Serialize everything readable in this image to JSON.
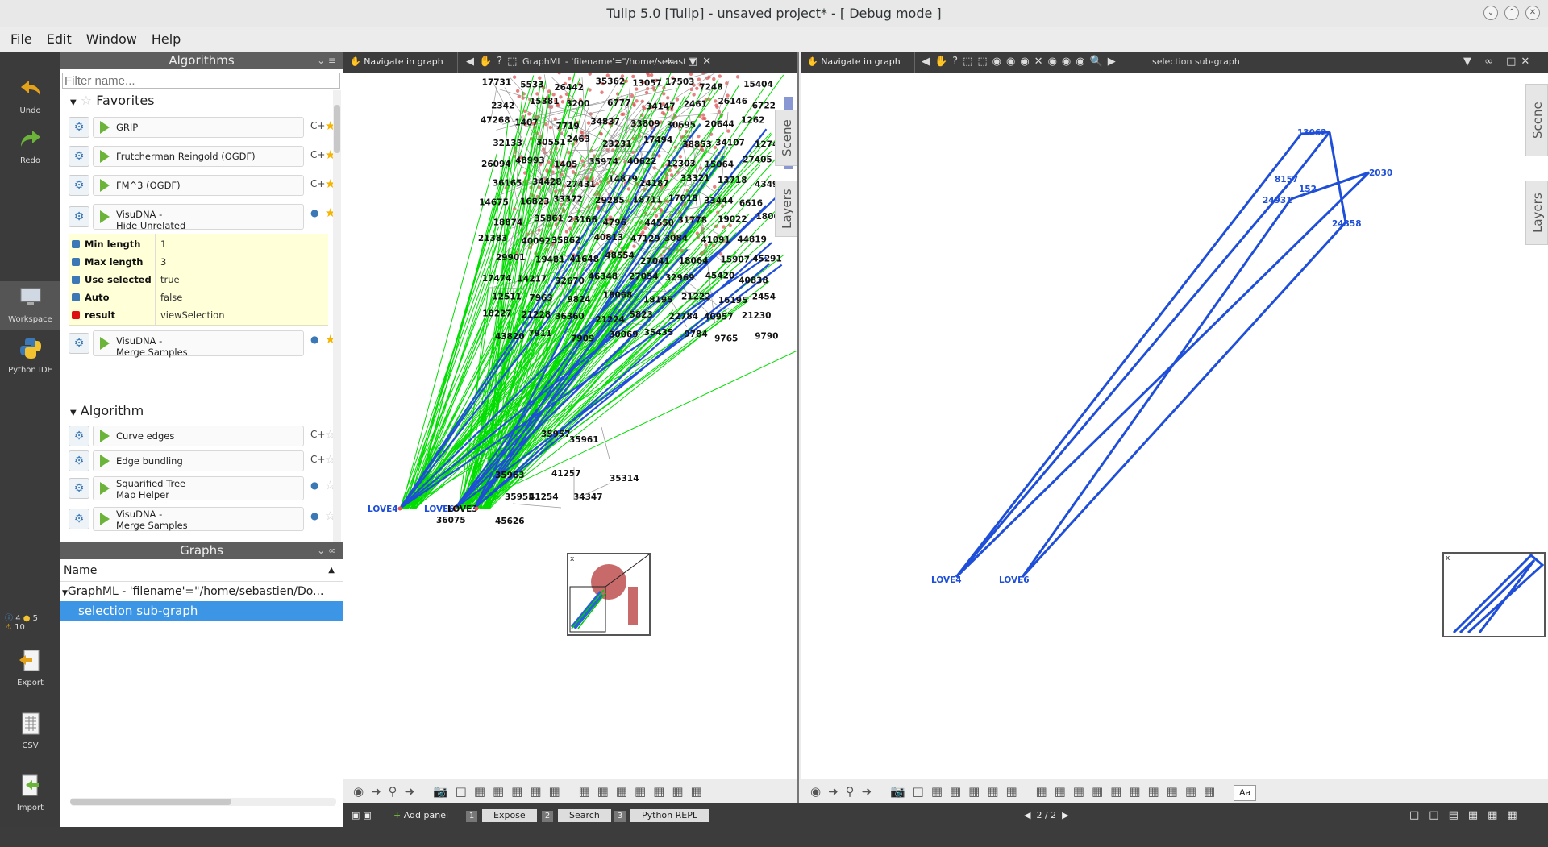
{
  "window": {
    "title": "Tulip 5.0 [Tulip] - unsaved project* - [ Debug mode ]"
  },
  "menu": [
    "File",
    "Edit",
    "Window",
    "Help"
  ],
  "dock": {
    "undo": "Undo",
    "redo": "Redo",
    "workspace": "Workspace",
    "python_ide": "Python IDE",
    "info_count": "4",
    "python_count": "5",
    "warning_count": "10",
    "export": "Export",
    "csv": "CSV",
    "import": "Import"
  },
  "algorithms": {
    "title": "Algorithms",
    "filter_placeholder": "Filter name...",
    "favorites_label": "Favorites",
    "algorithm_label": "Algorithm",
    "favorites": [
      {
        "name": "GRIP",
        "tag": "C+"
      },
      {
        "name": "Frutcherman Reingold (OGDF)",
        "tag": "C+"
      },
      {
        "name": "FM^3 (OGDF)",
        "tag": "C+"
      },
      {
        "name": "VisuDNA -\nHide Unrelated",
        "tag": "py"
      }
    ],
    "params": [
      {
        "key": "Min length",
        "value": "1"
      },
      {
        "key": "Max length",
        "value": "3"
      },
      {
        "key": "Use selected",
        "value": "true"
      },
      {
        "key": "Auto subgraph",
        "value": "false"
      },
      {
        "key": "result",
        "value": "viewSelection"
      }
    ],
    "fav_last": {
      "name": "VisuDNA -\nMerge Samples",
      "tag": "py"
    },
    "algorithm_items": [
      {
        "name": "Curve edges",
        "tag": "C+"
      },
      {
        "name": "Edge bundling",
        "tag": "C+"
      },
      {
        "name": "Squarified Tree\nMap Helper",
        "tag": "py"
      },
      {
        "name": "VisuDNA -\nMerge Samples",
        "tag": "py"
      }
    ]
  },
  "graphs": {
    "title": "Graphs",
    "column": "Name",
    "root": "GraphML - 'filename'=\"/home/sebastien/Do...",
    "child": "selection sub-graph"
  },
  "view1": {
    "mode": "Navigate in graph",
    "graph": "GraphML - 'filename'=\"/home/sebast",
    "side_tabs": [
      "Scene",
      "Layers"
    ],
    "labels": [
      "17731",
      "5533",
      "26442",
      "35362",
      "13057",
      "17503",
      "7248",
      "15404",
      "2342",
      "15381",
      "3200",
      "6777",
      "34147",
      "2461",
      "26146",
      "6722",
      "47268",
      "1407",
      "7719",
      "34837",
      "33809",
      "30695",
      "20644",
      "1262",
      "32133",
      "30551",
      "2463",
      "23231",
      "17494",
      "38853",
      "34107",
      "12748",
      "26094",
      "48993",
      "1405",
      "35974",
      "40622",
      "12303",
      "15064",
      "27405",
      "36165",
      "34428",
      "27431",
      "14879",
      "24187",
      "33321",
      "13718",
      "43490",
      "14675",
      "16823",
      "33372",
      "29285",
      "18711",
      "17018",
      "33444",
      "6616",
      "18874",
      "35861",
      "23166",
      "4796",
      "44550",
      "31778",
      "19022",
      "18065",
      "21383",
      "40092",
      "35862",
      "40813",
      "47129",
      "3084",
      "41091",
      "44819",
      "29901",
      "19481",
      "41648",
      "48554",
      "27041",
      "18064",
      "15907",
      "45291",
      "17474",
      "14217",
      "32670",
      "46348",
      "27054",
      "32969",
      "45420",
      "40838",
      "12511",
      "7963",
      "9824",
      "18068",
      "18195",
      "21222",
      "16195",
      "2454",
      "18227",
      "21228",
      "36360",
      "21224",
      "5823",
      "22784",
      "40957",
      "21230",
      "43820",
      "7911",
      "7909",
      "30069",
      "35435",
      "9784",
      "9765",
      "9790",
      "35957",
      "41257",
      "35963",
      "35955",
      "41254",
      "34347",
      "35314",
      "35961",
      "36075",
      "45626"
    ],
    "love_labels": [
      "LOVE4",
      "LOVE6",
      "LOVE3"
    ]
  },
  "view2": {
    "mode": "Navigate in graph",
    "graph": "selection sub-graph",
    "side_tabs": [
      "Scene",
      "Layers"
    ],
    "labels": [
      "13062",
      "2030",
      "8157",
      "152",
      "24931",
      "24358",
      "LOVE4",
      "LOVE6"
    ],
    "aa_button": "Aa"
  },
  "statusbar": {
    "add_panel": "Add panel",
    "tabs": [
      {
        "num": "1",
        "label": "Expose"
      },
      {
        "num": "2",
        "label": "Search"
      },
      {
        "num": "3",
        "label": "Python REPL"
      }
    ],
    "pager": "2 / 2"
  },
  "colors": {
    "selection": "#3c95e5",
    "edge_green": "#00dd00",
    "edge_blue": "#1f4fd8",
    "node_red": "#e05555"
  }
}
